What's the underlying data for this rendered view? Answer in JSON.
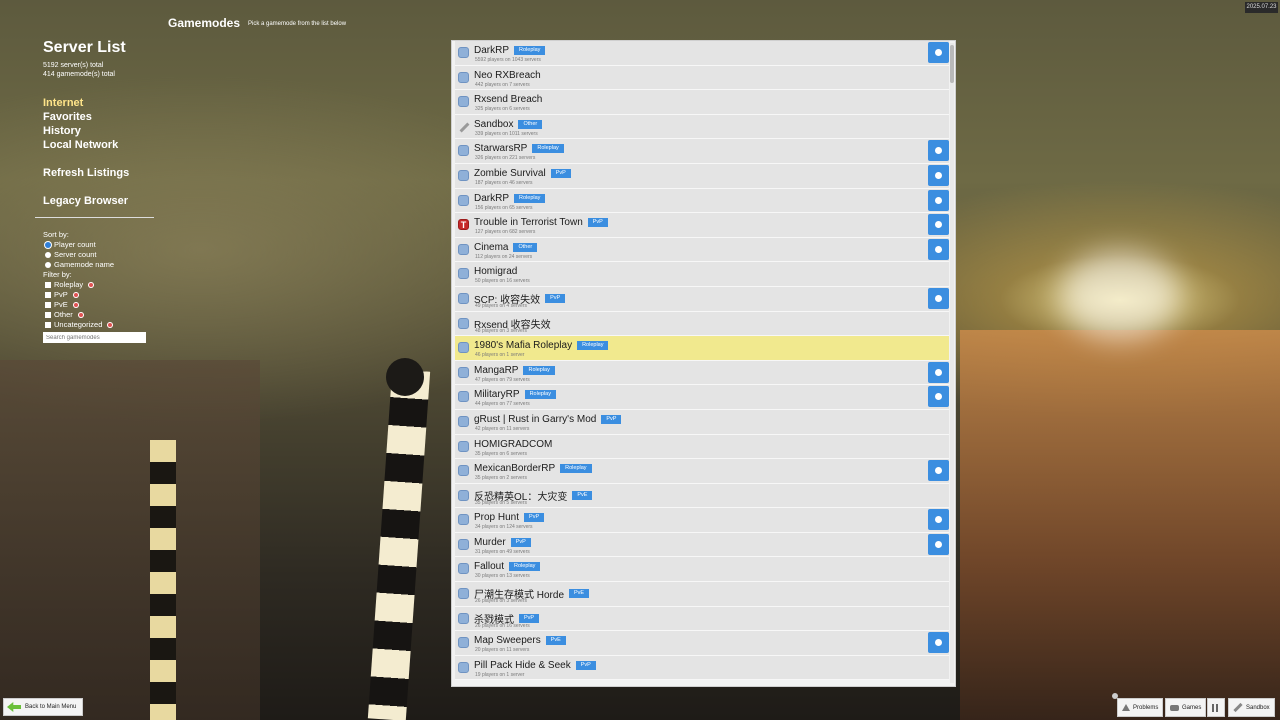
{
  "date_badge": "2025.07.23",
  "header": {
    "title": "Gamemodes",
    "subtitle": "Pick a gamemode from the list below"
  },
  "sidebar": {
    "title": "Server List",
    "servers_total": "5192 server(s) total",
    "gamemodes_total": "414 gamemode(s) total",
    "nav": [
      "Internet",
      "Favorites",
      "History",
      "Local Network"
    ],
    "refresh": "Refresh Listings",
    "legacy": "Legacy Browser",
    "sort_label": "Sort by:",
    "sort_options": [
      "Player count",
      "Server count",
      "Gamemode name"
    ],
    "filter_label": "Filter by:",
    "filters": [
      "Roleplay",
      "PvP",
      "PvE",
      "Other",
      "Uncategorized"
    ],
    "search_placeholder": "Search gamemodes"
  },
  "gamemodes": [
    {
      "name": "DarkRP",
      "tag": "Roleplay",
      "sub": "5592 players on 1043 servers",
      "icon": "box",
      "fav": true
    },
    {
      "name": "Neo RXBreach",
      "tag": "",
      "sub": "442 players on 7 servers",
      "icon": "box",
      "fav": false
    },
    {
      "name": "Rxsend Breach",
      "tag": "",
      "sub": "325 players on 6 servers",
      "icon": "box",
      "fav": false
    },
    {
      "name": "Sandbox",
      "tag": "Other",
      "sub": "339 players on 1011 servers",
      "icon": "tool",
      "fav": false
    },
    {
      "name": "StarwarsRP",
      "tag": "Roleplay",
      "sub": "326 players on 221 servers",
      "icon": "box",
      "fav": true
    },
    {
      "name": "Zombie Survival",
      "tag": "PvP",
      "sub": "187 players on 46 servers",
      "icon": "box",
      "fav": true
    },
    {
      "name": "DarkRP",
      "tag": "Roleplay",
      "sub": "156 players on 65 servers",
      "icon": "box",
      "fav": true
    },
    {
      "name": "Trouble in Terrorist Town",
      "tag": "PvP",
      "sub": "127 players on 682 servers",
      "icon": "t",
      "fav": true
    },
    {
      "name": "Cinema",
      "tag": "Other",
      "sub": "112 players on 24 servers",
      "icon": "box",
      "fav": true
    },
    {
      "name": "Homigrad",
      "tag": "",
      "sub": "50 players on 16 servers",
      "icon": "box",
      "fav": false
    },
    {
      "name": "SCP: 收容失效",
      "tag": "PvP",
      "sub": "49 players on 4 servers",
      "icon": "box",
      "fav": true
    },
    {
      "name": "Rxsend 收容失效",
      "tag": "",
      "sub": "48 players on 3 servers",
      "icon": "box",
      "fav": false
    },
    {
      "name": "1980's Mafia Roleplay",
      "tag": "Roleplay",
      "sub": "46 players on 1 server",
      "icon": "box",
      "fav": false,
      "highlight": true
    },
    {
      "name": "MangaRP",
      "tag": "Roleplay",
      "sub": "47 players on 79 servers",
      "icon": "box",
      "fav": true
    },
    {
      "name": "MilitaryRP",
      "tag": "Roleplay",
      "sub": "44 players on 77 servers",
      "icon": "box",
      "fav": true
    },
    {
      "name": "gRust | Rust in Garry's Mod",
      "tag": "PvP",
      "sub": "42 players on 11 servers",
      "icon": "box",
      "fav": false
    },
    {
      "name": "HOMIGRADCOM",
      "tag": "",
      "sub": "35 players on 6 servers",
      "icon": "box",
      "fav": false
    },
    {
      "name": "MexicanBorderRP",
      "tag": "Roleplay",
      "sub": "35 players on 2 servers",
      "icon": "box",
      "fav": true
    },
    {
      "name": "反恐精英OL：大灾变",
      "tag": "PvE",
      "sub": "35 players on 5 servers",
      "icon": "box",
      "fav": false
    },
    {
      "name": "Prop Hunt",
      "tag": "PvP",
      "sub": "34 players on 124 servers",
      "icon": "box",
      "fav": true
    },
    {
      "name": "Murder",
      "tag": "PvP",
      "sub": "31 players on 49 servers",
      "icon": "box",
      "fav": true
    },
    {
      "name": "Fallout",
      "tag": "Roleplay",
      "sub": "30 players on 13 servers",
      "icon": "box",
      "fav": false
    },
    {
      "name": "尸潮生存模式 Horde",
      "tag": "PvE",
      "sub": "26 players on 3 servers",
      "icon": "box",
      "fav": false
    },
    {
      "name": "杀戮模式",
      "tag": "PvP",
      "sub": "26 players on 16 servers",
      "icon": "box",
      "fav": false
    },
    {
      "name": "Map Sweepers",
      "tag": "PvE",
      "sub": "20 players on 11 servers",
      "icon": "box",
      "fav": true
    },
    {
      "name": "Pill Pack Hide & Seek",
      "tag": "PvP",
      "sub": "19 players on 1 server",
      "icon": "box",
      "fav": false
    }
  ],
  "bottom": {
    "back": "Back to Main Menu",
    "problems": "Problems",
    "games": "Games",
    "sandbox": "Sandbox"
  }
}
